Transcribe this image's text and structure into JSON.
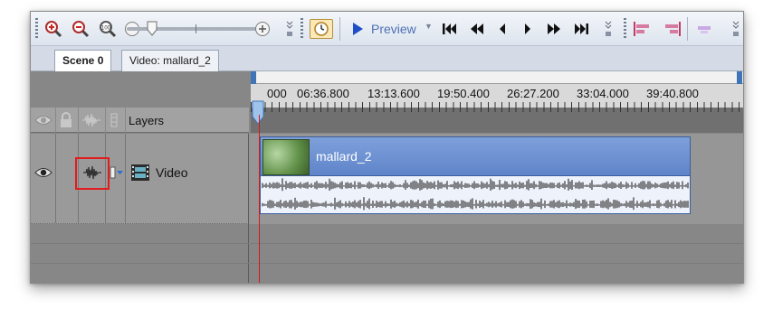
{
  "toolbar": {
    "zoom_in_icon": "zoom-in-magnifier",
    "zoom_out_icon": "zoom-out-magnifier",
    "zoom_100_label": "100",
    "preview_label": "Preview",
    "transport": [
      "go-to-start",
      "previous-frame-fast",
      "previous-frame",
      "play",
      "next-frame-fast",
      "go-to-end"
    ]
  },
  "tabs": [
    {
      "label": "Scene 0",
      "active": true
    },
    {
      "label": "Video: mallard_2",
      "active": false
    }
  ],
  "timeline": {
    "layers_label": "Layers",
    "ruler_labels": [
      "000",
      "06:36.800",
      "13:13.600",
      "19:50.400",
      "26:27.200",
      "33:04.000",
      "39:40.800"
    ],
    "track": {
      "name": "Video",
      "clip_title": "mallard_2"
    }
  },
  "colors": {
    "accent": "#3f74b6",
    "highlight": "#e21b1b",
    "clip": "#6b8fd2"
  }
}
